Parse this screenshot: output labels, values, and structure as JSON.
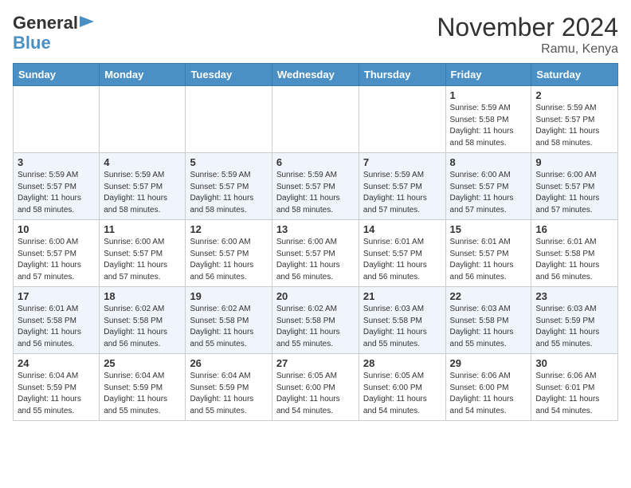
{
  "header": {
    "logo_line1": "General",
    "logo_line2": "Blue",
    "title": "November 2024",
    "subtitle": "Ramu, Kenya"
  },
  "weekdays": [
    "Sunday",
    "Monday",
    "Tuesday",
    "Wednesday",
    "Thursday",
    "Friday",
    "Saturday"
  ],
  "weeks": [
    [
      {
        "day": "",
        "info": ""
      },
      {
        "day": "",
        "info": ""
      },
      {
        "day": "",
        "info": ""
      },
      {
        "day": "",
        "info": ""
      },
      {
        "day": "",
        "info": ""
      },
      {
        "day": "1",
        "info": "Sunrise: 5:59 AM\nSunset: 5:58 PM\nDaylight: 11 hours\nand 58 minutes."
      },
      {
        "day": "2",
        "info": "Sunrise: 5:59 AM\nSunset: 5:57 PM\nDaylight: 11 hours\nand 58 minutes."
      }
    ],
    [
      {
        "day": "3",
        "info": "Sunrise: 5:59 AM\nSunset: 5:57 PM\nDaylight: 11 hours\nand 58 minutes."
      },
      {
        "day": "4",
        "info": "Sunrise: 5:59 AM\nSunset: 5:57 PM\nDaylight: 11 hours\nand 58 minutes."
      },
      {
        "day": "5",
        "info": "Sunrise: 5:59 AM\nSunset: 5:57 PM\nDaylight: 11 hours\nand 58 minutes."
      },
      {
        "day": "6",
        "info": "Sunrise: 5:59 AM\nSunset: 5:57 PM\nDaylight: 11 hours\nand 58 minutes."
      },
      {
        "day": "7",
        "info": "Sunrise: 5:59 AM\nSunset: 5:57 PM\nDaylight: 11 hours\nand 57 minutes."
      },
      {
        "day": "8",
        "info": "Sunrise: 6:00 AM\nSunset: 5:57 PM\nDaylight: 11 hours\nand 57 minutes."
      },
      {
        "day": "9",
        "info": "Sunrise: 6:00 AM\nSunset: 5:57 PM\nDaylight: 11 hours\nand 57 minutes."
      }
    ],
    [
      {
        "day": "10",
        "info": "Sunrise: 6:00 AM\nSunset: 5:57 PM\nDaylight: 11 hours\nand 57 minutes."
      },
      {
        "day": "11",
        "info": "Sunrise: 6:00 AM\nSunset: 5:57 PM\nDaylight: 11 hours\nand 57 minutes."
      },
      {
        "day": "12",
        "info": "Sunrise: 6:00 AM\nSunset: 5:57 PM\nDaylight: 11 hours\nand 56 minutes."
      },
      {
        "day": "13",
        "info": "Sunrise: 6:00 AM\nSunset: 5:57 PM\nDaylight: 11 hours\nand 56 minutes."
      },
      {
        "day": "14",
        "info": "Sunrise: 6:01 AM\nSunset: 5:57 PM\nDaylight: 11 hours\nand 56 minutes."
      },
      {
        "day": "15",
        "info": "Sunrise: 6:01 AM\nSunset: 5:57 PM\nDaylight: 11 hours\nand 56 minutes."
      },
      {
        "day": "16",
        "info": "Sunrise: 6:01 AM\nSunset: 5:58 PM\nDaylight: 11 hours\nand 56 minutes."
      }
    ],
    [
      {
        "day": "17",
        "info": "Sunrise: 6:01 AM\nSunset: 5:58 PM\nDaylight: 11 hours\nand 56 minutes."
      },
      {
        "day": "18",
        "info": "Sunrise: 6:02 AM\nSunset: 5:58 PM\nDaylight: 11 hours\nand 56 minutes."
      },
      {
        "day": "19",
        "info": "Sunrise: 6:02 AM\nSunset: 5:58 PM\nDaylight: 11 hours\nand 55 minutes."
      },
      {
        "day": "20",
        "info": "Sunrise: 6:02 AM\nSunset: 5:58 PM\nDaylight: 11 hours\nand 55 minutes."
      },
      {
        "day": "21",
        "info": "Sunrise: 6:03 AM\nSunset: 5:58 PM\nDaylight: 11 hours\nand 55 minutes."
      },
      {
        "day": "22",
        "info": "Sunrise: 6:03 AM\nSunset: 5:58 PM\nDaylight: 11 hours\nand 55 minutes."
      },
      {
        "day": "23",
        "info": "Sunrise: 6:03 AM\nSunset: 5:59 PM\nDaylight: 11 hours\nand 55 minutes."
      }
    ],
    [
      {
        "day": "24",
        "info": "Sunrise: 6:04 AM\nSunset: 5:59 PM\nDaylight: 11 hours\nand 55 minutes."
      },
      {
        "day": "25",
        "info": "Sunrise: 6:04 AM\nSunset: 5:59 PM\nDaylight: 11 hours\nand 55 minutes."
      },
      {
        "day": "26",
        "info": "Sunrise: 6:04 AM\nSunset: 5:59 PM\nDaylight: 11 hours\nand 55 minutes."
      },
      {
        "day": "27",
        "info": "Sunrise: 6:05 AM\nSunset: 6:00 PM\nDaylight: 11 hours\nand 54 minutes."
      },
      {
        "day": "28",
        "info": "Sunrise: 6:05 AM\nSunset: 6:00 PM\nDaylight: 11 hours\nand 54 minutes."
      },
      {
        "day": "29",
        "info": "Sunrise: 6:06 AM\nSunset: 6:00 PM\nDaylight: 11 hours\nand 54 minutes."
      },
      {
        "day": "30",
        "info": "Sunrise: 6:06 AM\nSunset: 6:01 PM\nDaylight: 11 hours\nand 54 minutes."
      }
    ]
  ]
}
